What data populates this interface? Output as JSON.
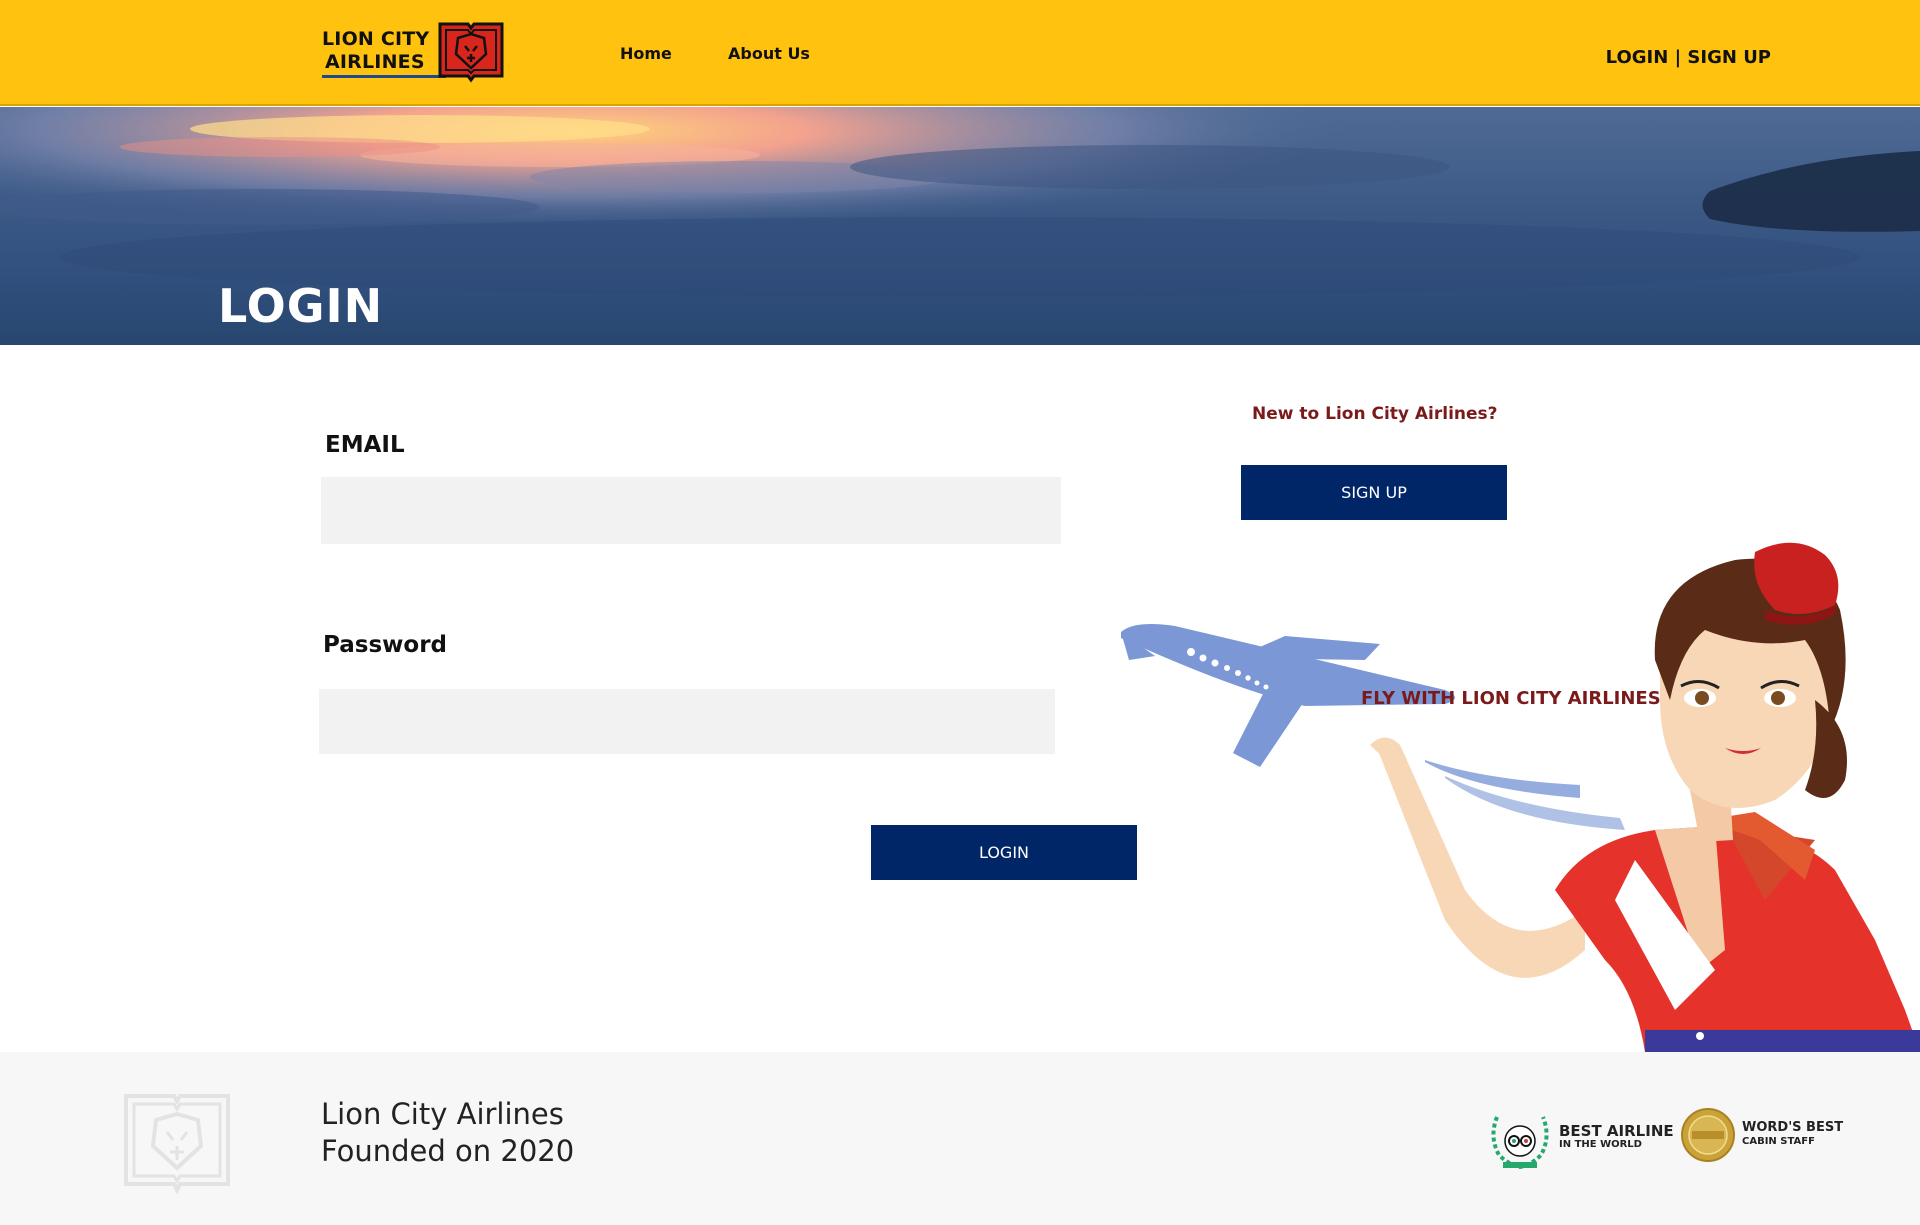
{
  "header": {
    "logo_line1": "LION CITY",
    "logo_line2": "AIRLINES",
    "nav": [
      {
        "label": "Home"
      },
      {
        "label": "About Us"
      }
    ],
    "login_link": "LOGIN",
    "separator": "|",
    "signup_link": "SIGN UP"
  },
  "hero": {
    "title": "LOGIN"
  },
  "form": {
    "email_label": "EMAIL",
    "email_value": "",
    "password_label": "Password",
    "password_value": "",
    "login_button": "LOGIN"
  },
  "signup_panel": {
    "prompt": "New to Lion City Airlines?",
    "button": "SIGN UP",
    "tagline": "FLY WITH LION CITY AIRLINES"
  },
  "footer": {
    "name": "Lion City Airlines",
    "founded": "Founded on 2020",
    "awards": [
      {
        "title": "BEST AIRLINE",
        "subtitle": "IN THE WORLD",
        "badge": "tripadvisor"
      },
      {
        "title": "WORD'S BEST",
        "subtitle": "CABIN STAFF",
        "badge": "SKYTRAX"
      }
    ]
  },
  "colors": {
    "header_bg": "#ffc20e",
    "button_bg": "#002668",
    "accent_text": "#7b1a1a",
    "input_bg": "#f2f2f2",
    "footer_bg": "#f7f7f7"
  }
}
